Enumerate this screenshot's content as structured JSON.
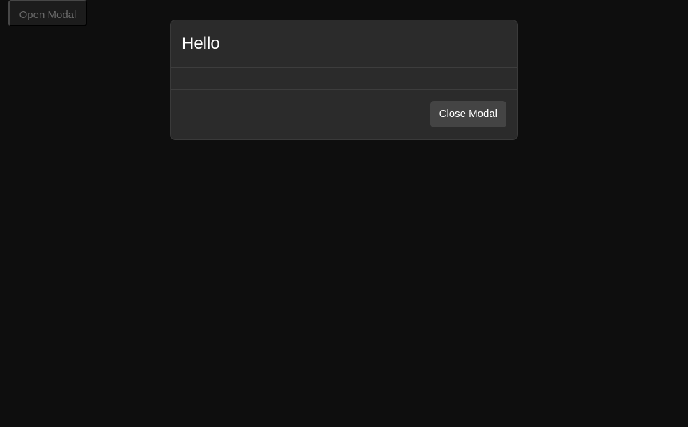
{
  "page": {
    "open_button_label": "Open Modal"
  },
  "modal": {
    "title": "Hello",
    "body_text": "",
    "close_button_label": "Close Modal"
  },
  "colors": {
    "background": "#111111",
    "modal_background": "#2b2b2b",
    "modal_border": "#3a3a3a",
    "button_background": "#444444",
    "open_button_background": "#222222",
    "title_text": "#ffffff",
    "muted_text": "#7c7c7c"
  }
}
